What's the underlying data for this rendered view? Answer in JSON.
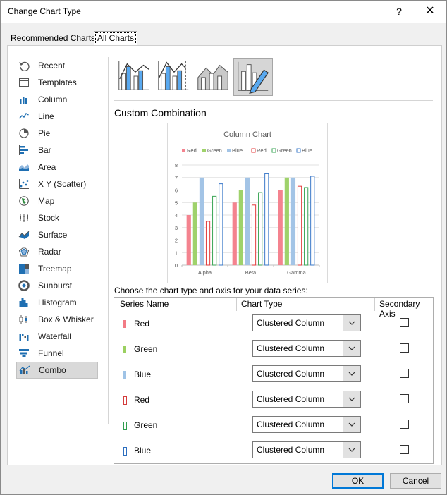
{
  "window": {
    "title": "Change Chart Type",
    "help": "?",
    "close": "✕"
  },
  "tabs": [
    {
      "label": "Recommended Charts"
    },
    {
      "label": "All Charts",
      "selected": true
    }
  ],
  "sidebar": {
    "items": [
      {
        "label": "Recent",
        "icon": "recent-icon"
      },
      {
        "label": "Templates",
        "icon": "templates-icon"
      },
      {
        "label": "Column",
        "icon": "column-chart-icon"
      },
      {
        "label": "Line",
        "icon": "line-chart-icon"
      },
      {
        "label": "Pie",
        "icon": "pie-chart-icon"
      },
      {
        "label": "Bar",
        "icon": "bar-chart-icon"
      },
      {
        "label": "Area",
        "icon": "area-chart-icon"
      },
      {
        "label": "X Y (Scatter)",
        "icon": "scatter-chart-icon"
      },
      {
        "label": "Map",
        "icon": "map-chart-icon"
      },
      {
        "label": "Stock",
        "icon": "stock-chart-icon"
      },
      {
        "label": "Surface",
        "icon": "surface-chart-icon"
      },
      {
        "label": "Radar",
        "icon": "radar-chart-icon"
      },
      {
        "label": "Treemap",
        "icon": "treemap-chart-icon"
      },
      {
        "label": "Sunburst",
        "icon": "sunburst-chart-icon"
      },
      {
        "label": "Histogram",
        "icon": "histogram-chart-icon"
      },
      {
        "label": "Box & Whisker",
        "icon": "box-whisker-chart-icon"
      },
      {
        "label": "Waterfall",
        "icon": "waterfall-chart-icon"
      },
      {
        "label": "Funnel",
        "icon": "funnel-chart-icon"
      },
      {
        "label": "Combo",
        "icon": "combo-chart-icon",
        "selected": true
      }
    ]
  },
  "variants": [
    {
      "name": "clustered-column-line",
      "icon": "clustered-column-line-icon"
    },
    {
      "name": "clustered-column-line-secondary-axis",
      "icon": "column-line-secondary-axis-icon"
    },
    {
      "name": "stacked-area-clustered-column",
      "icon": "stacked-area-column-icon"
    },
    {
      "name": "custom-combination",
      "icon": "custom-combination-icon",
      "selected": true
    }
  ],
  "section_title": "Custom Combination",
  "chart_data": {
    "type": "bar",
    "title": "Column Chart",
    "categories": [
      "Alpha",
      "Beta",
      "Gamma"
    ],
    "ylim": [
      0,
      8
    ],
    "yticks": [
      "0",
      "1",
      "2",
      "3",
      "4",
      "5",
      "6",
      "7",
      "8"
    ],
    "grid": true,
    "legend_position": "top",
    "series": [
      {
        "name": "Red",
        "values": [
          4,
          5,
          6
        ],
        "color": "#f4838f",
        "style": "filled"
      },
      {
        "name": "Green",
        "values": [
          5,
          6,
          7
        ],
        "color": "#9fd26b",
        "style": "filled"
      },
      {
        "name": "Blue",
        "values": [
          7,
          7,
          7
        ],
        "color": "#a3c4e6",
        "style": "filled"
      },
      {
        "name": "Red",
        "values": [
          3.5,
          4.8,
          6.3
        ],
        "color": "#e33b3b",
        "style": "outline"
      },
      {
        "name": "Green",
        "values": [
          5.5,
          5.8,
          6.2
        ],
        "color": "#3aa655",
        "style": "outline"
      },
      {
        "name": "Blue",
        "values": [
          6.5,
          7.3,
          7.1
        ],
        "color": "#3a78c9",
        "style": "outline"
      }
    ]
  },
  "series_section": {
    "label": "Choose the chart type and axis for your data series:",
    "headers": {
      "series_name": "Series Name",
      "chart_type": "Chart Type",
      "secondary_axis": "Secondary Axis"
    },
    "rows": [
      {
        "name": "Red",
        "color": "#f27b85",
        "outline": false,
        "chart_type": "Clustered Column",
        "secondary_axis": false
      },
      {
        "name": "Green",
        "color": "#9bd060",
        "outline": false,
        "chart_type": "Clustered Column",
        "secondary_axis": false
      },
      {
        "name": "Blue",
        "color": "#9fc3e6",
        "outline": false,
        "chart_type": "Clustered Column",
        "secondary_axis": false
      },
      {
        "name": "Red",
        "color": "#d43c3c",
        "outline": true,
        "chart_type": "Clustered Column",
        "secondary_axis": false
      },
      {
        "name": "Green",
        "color": "#2f9e4f",
        "outline": true,
        "chart_type": "Clustered Column",
        "secondary_axis": false
      },
      {
        "name": "Blue",
        "color": "#2e6fbf",
        "outline": true,
        "chart_type": "Clustered Column",
        "secondary_axis": false
      }
    ]
  },
  "buttons": {
    "ok": "OK",
    "cancel": "Cancel"
  }
}
